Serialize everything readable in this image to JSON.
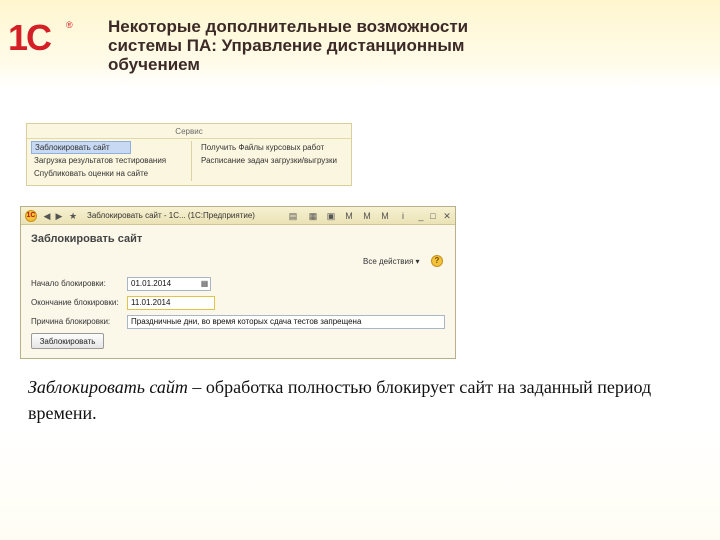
{
  "header": {
    "logo_text": "1С",
    "logo_mark": "®",
    "title_lines": [
      "Некоторые дополнительные возможности",
      "системы ПА: Управление дистанционным",
      "обучением"
    ]
  },
  "service_menu": {
    "title": "Сервис",
    "left_items": [
      "Заблокировать сайт",
      "Загрузка результатов тестирования",
      "Спубликовать оценки на сайте"
    ],
    "right_items": [
      "Получить Файлы курсовых работ",
      "Расписание задач загрузки/выгрузки"
    ]
  },
  "window": {
    "titlebar": {
      "title": "Заблокировать сайт - 1С... (1С:Предприятие)",
      "logo_icon": "1c-logo-icon",
      "icons": [
        "back-arrow-icon",
        "forward-arrow-icon",
        "star-icon",
        "document-icon",
        "calculator-icon",
        "calendar-icon",
        "memory-plus-icon",
        "memory-minus-icon",
        "memory-icon",
        "info-icon",
        "minimize-icon",
        "restore-icon",
        "close-icon"
      ]
    },
    "form_title": "Заблокировать сайт",
    "all_actions_label": "Все действия ▾",
    "help_label": "?",
    "fields": {
      "start": {
        "label": "Начало блокировки:",
        "value": "01.01.2014"
      },
      "end": {
        "label": "Окончание блокировки:",
        "value": "11.01.2014"
      },
      "reason": {
        "label": "Причина блокировки:",
        "value": "Праздничные дни, во время которых сдача  тестов запрещена"
      }
    },
    "submit_label": "Заблокировать"
  },
  "caption": {
    "emphasis": "Заблокировать сайт",
    "rest": " – обработка полностью блокирует сайт на заданный период времени."
  }
}
